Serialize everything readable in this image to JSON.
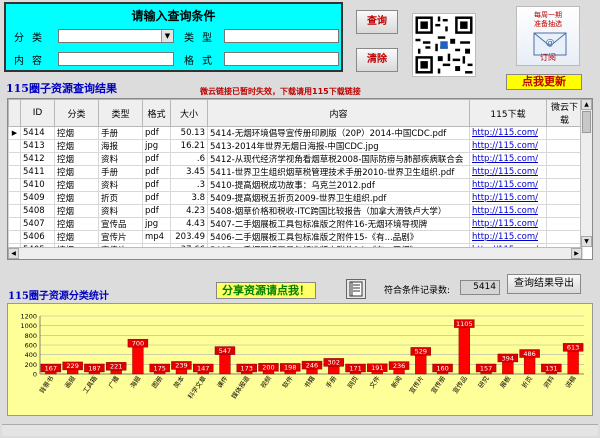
{
  "search": {
    "title": "请输入查询条件",
    "labels": {
      "category": "分类",
      "type": "类型",
      "content": "内容",
      "format": "格式"
    },
    "query_button": "查询",
    "clear_button": "清除"
  },
  "mail_card": {
    "line1": "每周一期",
    "line2": "准备抽选",
    "subscribe": "订阅"
  },
  "update_button": "点我更新",
  "results": {
    "title": "115圈子资源查询结果",
    "notice": "微云链接已暂时失效，下载请用115下载链接",
    "columns": [
      "ID",
      "分类",
      "类型",
      "格式",
      "大小",
      "内容",
      "115下载",
      "微云下载"
    ],
    "rows": [
      [
        "5414",
        "控烟",
        "手册",
        "pdf",
        "50.13",
        "5414-无烟环境倡导宣传册印刷版（20P）2014-中国CDC.pdf",
        "http://115.com/",
        ""
      ],
      [
        "5413",
        "控烟",
        "海报",
        "jpg",
        "16.21",
        "5413-2014年世界无烟日海报-中国CDC.jpg",
        "http://115.com/",
        ""
      ],
      [
        "5412",
        "控烟",
        "资料",
        "pdf",
        ".6",
        "5412-从现代经济学视角看烟草税2008-国际防痨与肺部疾病联合会",
        "http://115.com/",
        ""
      ],
      [
        "5411",
        "控烟",
        "手册",
        "pdf",
        "3.45",
        "5411-世界卫生组织烟草税管理技术手册2010-世界卫生组织.pdf",
        "http://115.com/",
        ""
      ],
      [
        "5410",
        "控烟",
        "资料",
        "pdf",
        ".3",
        "5410-提高烟税成功故事：乌克兰2012.pdf",
        "http://115.com/",
        ""
      ],
      [
        "5409",
        "控烟",
        "折页",
        "pdf",
        "3.8",
        "5409-提高烟税五折页2009-世界卫生组织.pdf",
        "http://115.com/",
        ""
      ],
      [
        "5408",
        "控烟",
        "资料",
        "pdf",
        "4.23",
        "5408-烟草价格和税收-ITC跨国比较报告（加拿大滑铁卢大学）",
        "http://115.com/",
        ""
      ],
      [
        "5407",
        "控烟",
        "宣传品",
        "jpg",
        "4.43",
        "5407-二手烟展板工具包标准版之附件16-无烟环境导视牌",
        "http://115.com/",
        ""
      ],
      [
        "5406",
        "控烟",
        "宣传片",
        "mp4",
        "203.49",
        "5406-二手烟展板工具包标准版之附件15-《有...品剧》",
        "http://115.com/",
        ""
      ],
      [
        "5405",
        "控烟",
        "宣传片",
        "wav",
        "37.66",
        "5405-二手烟展板工具包标准版之附件14-《有...无烟》",
        "http://115.com/",
        ""
      ],
      [
        "5404",
        "控烟",
        "宣传片",
        "mp3",
        "2.51",
        "5404-二手烟展板工具包标准版之附件13-《控...曲曲》",
        "http://115.com/",
        ""
      ]
    ]
  },
  "stats": {
    "title": "115圈子资源分类统计",
    "share_button": "分享资源请点我！",
    "count_label": "符合条件记录数:",
    "count_value": "5414",
    "export_button": "查询结果导出"
  },
  "colors": {
    "panel": "#00ffff",
    "bar": "#ff0000",
    "chart_bg": "#ffff99",
    "title_blue": "#0000c0",
    "link": "#0000d0"
  },
  "chart_data": {
    "type": "bar",
    "categories": [
      "背景书",
      "画报",
      "工具箱",
      "广播",
      "海报",
      "图册",
      "简本",
      "科学文章",
      "课件",
      "媒体报道",
      "视频",
      "软件",
      "书籍",
      "手册",
      "网页",
      "文件",
      "新闻",
      "宣传片",
      "宣传册",
      "宣传品",
      "研究",
      "展板",
      "折页",
      "资料",
      "讲稿"
    ],
    "values": [
      167,
      229,
      187,
      221,
      700,
      175,
      239,
      147,
      547,
      173,
      200,
      198,
      246,
      302,
      171,
      191,
      236,
      529,
      160,
      1105,
      157,
      394,
      486,
      131,
      613
    ],
    "ylim": [
      0,
      1200
    ],
    "yticks": [
      0,
      200,
      400,
      600,
      800,
      1000,
      1200
    ],
    "grid": true
  }
}
